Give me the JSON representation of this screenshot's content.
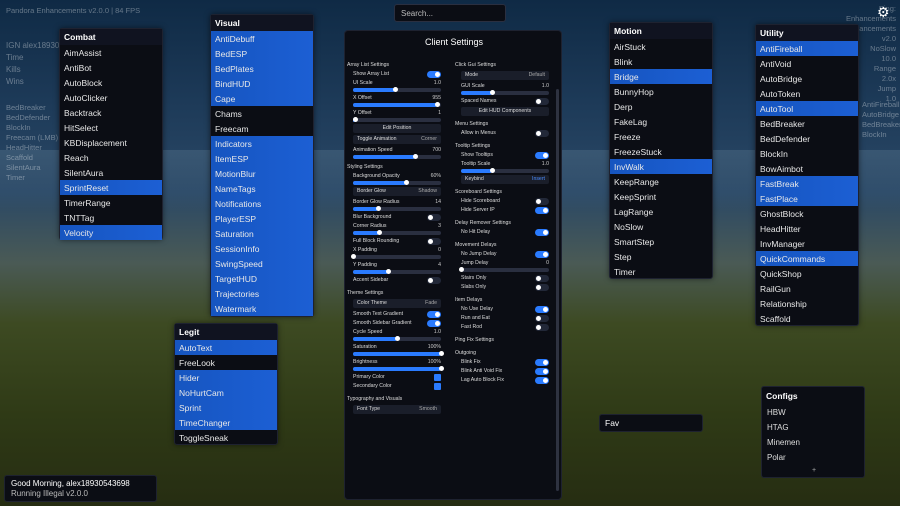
{
  "hud": {
    "top_left": "Pandora Enhancements v2.0.0 | 84 FPS",
    "lines": [
      "IGN alex189305",
      "Time",
      "Kills",
      "Wins"
    ],
    "left_list": [
      "BedBreaker",
      "BedDefender",
      "BlockIn",
      "Freecam (LMB)",
      "HeadHitter",
      "Scaffold",
      "SilentAura",
      "Timer"
    ],
    "right_top": [
      "Ping: Enhancements",
      "Enhancements v2.0",
      "NoSlow",
      "10.0",
      "Range",
      "2.0x",
      "Jump",
      "1.0"
    ],
    "right_list": [
      "AntiFireball",
      "AutoBridge",
      "BedBreaker",
      "BlockIn"
    ]
  },
  "search": {
    "placeholder": "Search..."
  },
  "combat": {
    "title": "Combat",
    "items": [
      {
        "label": "AimAssist",
        "on": false
      },
      {
        "label": "AntiBot",
        "on": false
      },
      {
        "label": "AutoBlock",
        "on": false
      },
      {
        "label": "AutoClicker",
        "on": false
      },
      {
        "label": "Backtrack",
        "on": false
      },
      {
        "label": "HitSelect",
        "on": false
      },
      {
        "label": "KBDisplacement",
        "on": false
      },
      {
        "label": "Reach",
        "on": false
      },
      {
        "label": "SilentAura",
        "on": false
      },
      {
        "label": "SprintReset",
        "on": true
      },
      {
        "label": "TimerRange",
        "on": false
      },
      {
        "label": "TNTTag",
        "on": false
      },
      {
        "label": "Velocity",
        "on": true
      }
    ]
  },
  "visual": {
    "title": "Visual",
    "items": [
      {
        "label": "AntiDebuff",
        "on": true
      },
      {
        "label": "BedESP",
        "on": true
      },
      {
        "label": "BedPlates",
        "on": true
      },
      {
        "label": "BindHUD",
        "on": true
      },
      {
        "label": "Cape",
        "on": true
      },
      {
        "label": "Chams",
        "on": false
      },
      {
        "label": "Freecam",
        "on": false
      },
      {
        "label": "Indicators",
        "on": true
      },
      {
        "label": "ItemESP",
        "on": true
      },
      {
        "label": "MotionBlur",
        "on": true
      },
      {
        "label": "NameTags",
        "on": true
      },
      {
        "label": "Notifications",
        "on": true
      },
      {
        "label": "PlayerESP",
        "on": true
      },
      {
        "label": "Saturation",
        "on": true
      },
      {
        "label": "SessionInfo",
        "on": true
      },
      {
        "label": "SwingSpeed",
        "on": true
      },
      {
        "label": "TargetHUD",
        "on": true
      },
      {
        "label": "Trajectories",
        "on": true
      },
      {
        "label": "Watermark",
        "on": true
      }
    ]
  },
  "legit": {
    "title": "Legit",
    "items": [
      {
        "label": "AutoText",
        "on": true
      },
      {
        "label": "FreeLook",
        "on": false
      },
      {
        "label": "Hider",
        "on": true
      },
      {
        "label": "NoHurtCam",
        "on": true
      },
      {
        "label": "Sprint",
        "on": true
      },
      {
        "label": "TimeChanger",
        "on": true
      },
      {
        "label": "ToggleSneak",
        "on": false
      }
    ]
  },
  "motion": {
    "title": "Motion",
    "items": [
      {
        "label": "AirStuck",
        "on": false
      },
      {
        "label": "Blink",
        "on": false
      },
      {
        "label": "Bridge",
        "on": true
      },
      {
        "label": "BunnyHop",
        "on": false
      },
      {
        "label": "Derp",
        "on": false
      },
      {
        "label": "FakeLag",
        "on": false
      },
      {
        "label": "Freeze",
        "on": false
      },
      {
        "label": "FreezeStuck",
        "on": false
      },
      {
        "label": "InvWalk",
        "on": true
      },
      {
        "label": "KeepRange",
        "on": false
      },
      {
        "label": "KeepSprint",
        "on": false
      },
      {
        "label": "LagRange",
        "on": false
      },
      {
        "label": "NoSlow",
        "on": false
      },
      {
        "label": "SmartStep",
        "on": false
      },
      {
        "label": "Step",
        "on": false
      },
      {
        "label": "Timer",
        "on": false
      }
    ]
  },
  "utility": {
    "title": "Utility",
    "items": [
      {
        "label": "AntiFireball",
        "on": true
      },
      {
        "label": "AntiVoid",
        "on": false
      },
      {
        "label": "AutoBridge",
        "on": false
      },
      {
        "label": "AutoToken",
        "on": false
      },
      {
        "label": "AutoTool",
        "on": true
      },
      {
        "label": "BedBreaker",
        "on": false
      },
      {
        "label": "BedDefender",
        "on": false
      },
      {
        "label": "BlockIn",
        "on": false
      },
      {
        "label": "BowAimbot",
        "on": false
      },
      {
        "label": "FastBreak",
        "on": true
      },
      {
        "label": "FastPlace",
        "on": true
      },
      {
        "label": "GhostBlock",
        "on": false
      },
      {
        "label": "HeadHitter",
        "on": false
      },
      {
        "label": "InvManager",
        "on": false
      },
      {
        "label": "QuickCommands",
        "on": true
      },
      {
        "label": "QuickShop",
        "on": false
      },
      {
        "label": "RailGun",
        "on": false
      },
      {
        "label": "Relationship",
        "on": false
      },
      {
        "label": "Scaffold",
        "on": false
      }
    ]
  },
  "client_settings": {
    "title": "Client Settings",
    "left": [
      {
        "t": "h",
        "label": "Array List Settings"
      },
      {
        "t": "toggle",
        "label": "Show Array List",
        "on": true
      },
      {
        "t": "slider",
        "label": "UI Scale",
        "value": "1.0",
        "frac": 0.48
      },
      {
        "t": "slider",
        "label": "X Offset",
        "value": "955",
        "frac": 0.95
      },
      {
        "t": "slider",
        "label": "Y Offset",
        "value": "1",
        "frac": 0.02
      },
      {
        "t": "btn",
        "label": "Edit Position"
      },
      {
        "t": "sel",
        "label": "Toggle Animation",
        "value": "Corner"
      },
      {
        "t": "slider",
        "label": "Animation Speed",
        "value": "700",
        "frac": 0.7
      },
      {
        "t": "h",
        "label": "Styling Settings"
      },
      {
        "t": "slider",
        "label": "Background Opacity",
        "value": "60%",
        "frac": 0.6
      },
      {
        "t": "sel",
        "label": "Border Glow",
        "value": "Shadow"
      },
      {
        "t": "slider",
        "label": "Border Glow Radius",
        "value": "14",
        "frac": 0.28
      },
      {
        "t": "toggle",
        "label": "Blur Background",
        "on": false
      },
      {
        "t": "slider",
        "label": "Corner Radius",
        "value": "3",
        "frac": 0.3
      },
      {
        "t": "toggle",
        "label": "Full Block Rounding",
        "on": false
      },
      {
        "t": "slider",
        "label": "X Padding",
        "value": "0",
        "frac": 0.0
      },
      {
        "t": "slider",
        "label": "Y Padding",
        "value": "4",
        "frac": 0.4
      },
      {
        "t": "toggle",
        "label": "Accent Sidebar",
        "on": false
      },
      {
        "t": "h",
        "label": "Theme Settings"
      },
      {
        "t": "sel",
        "label": "Color Theme",
        "value": "Fade"
      },
      {
        "t": "toggle",
        "label": "Smooth Text Gradient",
        "on": true
      },
      {
        "t": "toggle",
        "label": "Smooth Sidebar Gradient",
        "on": true
      },
      {
        "t": "slider",
        "label": "Cycle Speed",
        "value": "1.0",
        "frac": 0.5
      },
      {
        "t": "slider",
        "label": "Saturation",
        "value": "100%",
        "frac": 1.0
      },
      {
        "t": "slider",
        "label": "Brightness",
        "value": "100%",
        "frac": 1.0
      },
      {
        "t": "color",
        "label": "Primary Color"
      },
      {
        "t": "color",
        "label": "Secondary Color"
      },
      {
        "t": "h",
        "label": "Typography and Visuals"
      },
      {
        "t": "sel",
        "label": "Font Type",
        "value": "Smooth"
      }
    ],
    "right": [
      {
        "t": "h",
        "label": "Click Gui Settings"
      },
      {
        "t": "sel",
        "label": "Mode",
        "value": "Default"
      },
      {
        "t": "slider",
        "label": "GUI Scale",
        "value": "1.0",
        "frac": 0.35
      },
      {
        "t": "toggle",
        "label": "Spaced Names",
        "on": false
      },
      {
        "t": "btn",
        "label": "Edit HUD Components"
      },
      {
        "t": "h",
        "label": "Menu Settings"
      },
      {
        "t": "toggle",
        "label": "Allow in Menus",
        "on": false
      },
      {
        "t": "h",
        "label": "Tooltip Settings"
      },
      {
        "t": "toggle",
        "label": "Show Tooltips",
        "on": true
      },
      {
        "t": "slider",
        "label": "Tooltip Scale",
        "value": "1.0",
        "frac": 0.35
      },
      {
        "t": "sel",
        "label": "Keybind",
        "value": "Insert"
      },
      {
        "t": "h",
        "label": "Scoreboard Settings"
      },
      {
        "t": "toggle",
        "label": "Hide Scoreboard",
        "on": false
      },
      {
        "t": "toggle",
        "label": "Hide Server IP",
        "on": true
      },
      {
        "t": "h",
        "label": "Delay Remover Settings"
      },
      {
        "t": "toggle",
        "label": "No Hit Delay",
        "on": true
      },
      {
        "t": "h",
        "label": "Movement Delays"
      },
      {
        "t": "toggle",
        "label": "No Jump Delay",
        "on": true
      },
      {
        "t": "slider",
        "label": "Jump Delay",
        "value": "0",
        "frac": 0.0
      },
      {
        "t": "toggle",
        "label": "Stairs Only",
        "on": false
      },
      {
        "t": "toggle",
        "label": "Slabs Only",
        "on": false
      },
      {
        "t": "h",
        "label": "Item Delays"
      },
      {
        "t": "toggle",
        "label": "No Use Delay",
        "on": true
      },
      {
        "t": "toggle",
        "label": "Run and Eat",
        "on": false
      },
      {
        "t": "toggle",
        "label": "Fast Rod",
        "on": false
      },
      {
        "t": "h",
        "label": "Ping Fix Settings"
      },
      {
        "t": "h",
        "label": "Outgoing"
      },
      {
        "t": "toggle",
        "label": "Blink Fix",
        "on": true
      },
      {
        "t": "toggle",
        "label": "Blink Anti Void Fix",
        "on": true
      },
      {
        "t": "toggle",
        "label": "Lag Auto Block Fix",
        "on": true
      }
    ]
  },
  "fav": {
    "title": "Fav"
  },
  "configs": {
    "title": "Configs",
    "items": [
      "HBW",
      "HTAG",
      "Minemen",
      "Polar"
    ],
    "add": "+"
  },
  "greeting": {
    "line1": "Good Morning, alex18930543698",
    "line2": "Running Illegal v2.0.0"
  },
  "colors": {
    "accent": "#1c5fd4",
    "toggle_on": "#2a7bff",
    "panel": "#0b0d14"
  }
}
